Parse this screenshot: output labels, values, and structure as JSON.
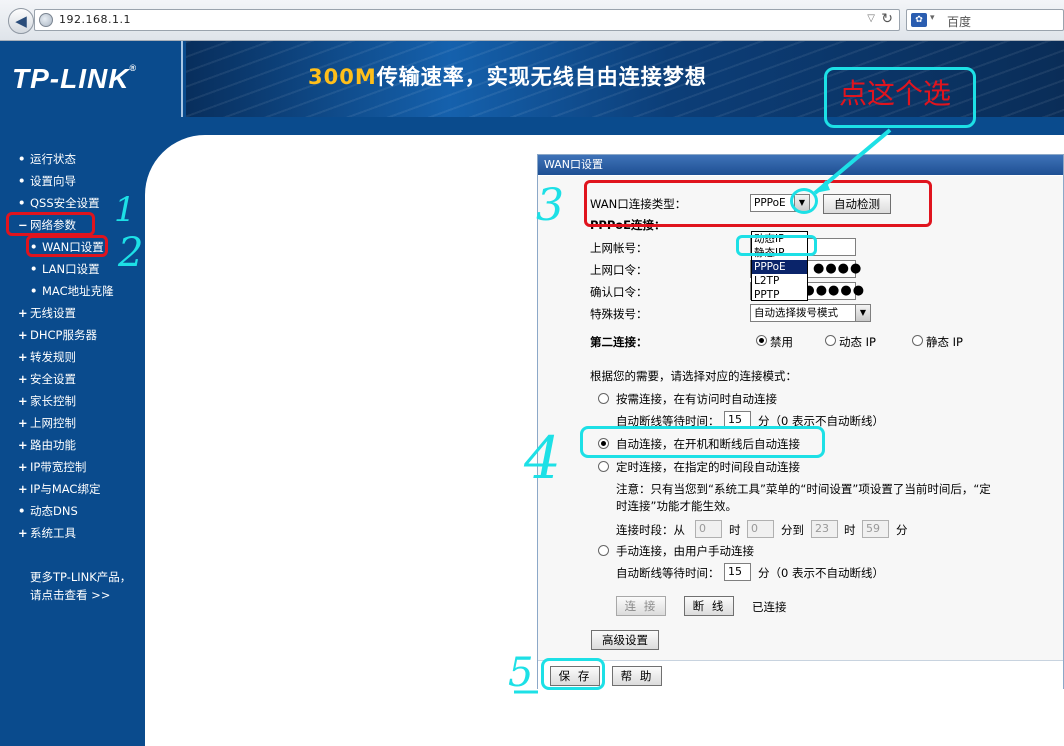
{
  "browser": {
    "url": "192.168.1.1",
    "search_engine": "百度",
    "back_icon": "back-arrow-icon",
    "reload_icon": "reload-icon"
  },
  "header": {
    "logo": "TP-LINK",
    "slogan_num": "300M",
    "slogan_rest": "传输速率，实现无线自由连接梦想"
  },
  "sidebar": {
    "items": [
      {
        "bullet": "•",
        "label": "运行状态"
      },
      {
        "bullet": "•",
        "label": "设置向导"
      },
      {
        "bullet": "•",
        "label": "QSS安全设置"
      },
      {
        "bullet": "−",
        "label": "网络参数"
      },
      {
        "bullet": "•",
        "label": "WAN口设置"
      },
      {
        "bullet": "•",
        "label": "LAN口设置"
      },
      {
        "bullet": "•",
        "label": "MAC地址克隆"
      },
      {
        "bullet": "+",
        "label": "无线设置"
      },
      {
        "bullet": "+",
        "label": "DHCP服务器"
      },
      {
        "bullet": "+",
        "label": "转发规则"
      },
      {
        "bullet": "+",
        "label": "安全设置"
      },
      {
        "bullet": "+",
        "label": "家长控制"
      },
      {
        "bullet": "+",
        "label": "上网控制"
      },
      {
        "bullet": "+",
        "label": "路由功能"
      },
      {
        "bullet": "+",
        "label": "IP带宽控制"
      },
      {
        "bullet": "+",
        "label": "IP与MAC绑定"
      },
      {
        "bullet": "•",
        "label": "动态DNS"
      },
      {
        "bullet": "+",
        "label": "系统工具"
      }
    ],
    "more_line1": "更多TP-LINK产品，",
    "more_line2": "请点击查看 >>"
  },
  "panel": {
    "title": "WAN口设置",
    "wan_type_label": "WAN口连接类型：",
    "wan_type_value": "PPPoE",
    "auto_detect": "自动检测",
    "pppoe_label": "PPPoE连接：",
    "dropdown_options": [
      "动态IP",
      "静态IP",
      "PPPoE",
      "L2TP",
      "PPTP"
    ],
    "username_label": "上网帐号：",
    "password_label": "上网口令：",
    "password_value": "●●●●",
    "confirm_label": "确认口令：",
    "confirm_value": "●●●●●●●●●",
    "dial_label": "特殊拨号：",
    "dial_value": "自动选择拨号模式",
    "second_label": "第二连接：",
    "second_opts": [
      "禁用",
      "动态 IP",
      "静态 IP"
    ],
    "mode_hint": "根据您的需要，请选择对应的连接模式：",
    "mode_demand": "按需连接，在有访问时自动连接",
    "idle_label": "自动断线等待时间：",
    "idle_value": "15",
    "idle_unit": "分（0 表示不自动断线）",
    "mode_auto": "自动连接，在开机和断线后自动连接",
    "mode_timed": "定时连接，在指定的时间段自动连接",
    "note_line1": "注意：只有当您到“系统工具”菜单的“时间设置”项设置了当前时间后，“定",
    "note_line2": "时连接”功能才能生效。",
    "period_label": "连接时段：从",
    "period_h1": "0",
    "period_m1": "0",
    "period_h2": "23",
    "period_m2": "59",
    "hour_unit": "时",
    "min_to": "分到",
    "min_unit": "分",
    "mode_manual": "手动连接，由用户手动连接",
    "idle2_value": "15",
    "connect_btn": "连 接",
    "disconnect_btn": "断 线",
    "status": "已连接",
    "advanced_btn": "高级设置",
    "save_btn": "保 存",
    "help_btn": "帮 助"
  },
  "annotations": {
    "callout": "点这个选",
    "n1": "1",
    "n2": "2",
    "n3": "3",
    "n4": "4",
    "n5": "5"
  }
}
